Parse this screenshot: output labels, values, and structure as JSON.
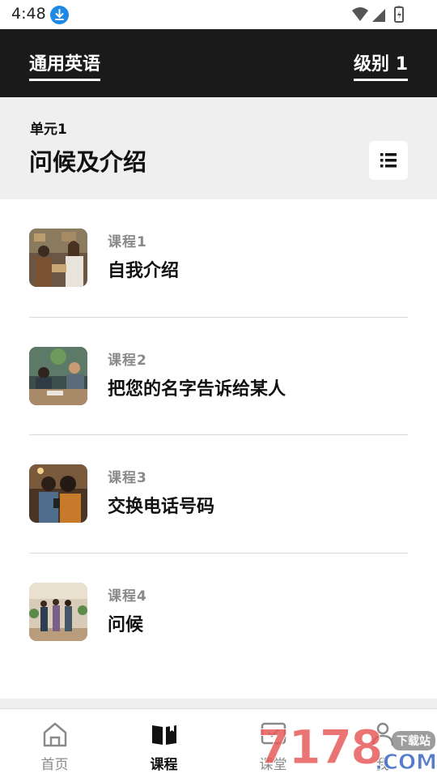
{
  "status_bar": {
    "time": "4:48"
  },
  "header": {
    "course_title": "通用英语",
    "level": "级别 1"
  },
  "unit": {
    "label": "单元1",
    "title": "问候及介绍"
  },
  "lessons": [
    {
      "number": "课程1",
      "title": "自我介绍"
    },
    {
      "number": "课程2",
      "title": "把您的名字告诉给某人"
    },
    {
      "number": "课程3",
      "title": "交换电话号码"
    },
    {
      "number": "课程4",
      "title": "问候"
    }
  ],
  "bottom_nav": {
    "items": [
      {
        "label": "首页",
        "icon": "home-icon",
        "active": false
      },
      {
        "label": "课程",
        "icon": "book-icon",
        "active": true
      },
      {
        "label": "课堂",
        "icon": "classroom-icon",
        "active": false
      },
      {
        "label": "我",
        "icon": "person-icon",
        "active": false
      }
    ]
  },
  "watermark": {
    "text": "7178",
    "tag": "下载站",
    "domain": ".COM"
  },
  "colors": {
    "header_bg": "#1a1a1a",
    "unit_bg": "#efefef",
    "muted_text": "#8a8a8a",
    "download_badge": "#1e88e5"
  }
}
